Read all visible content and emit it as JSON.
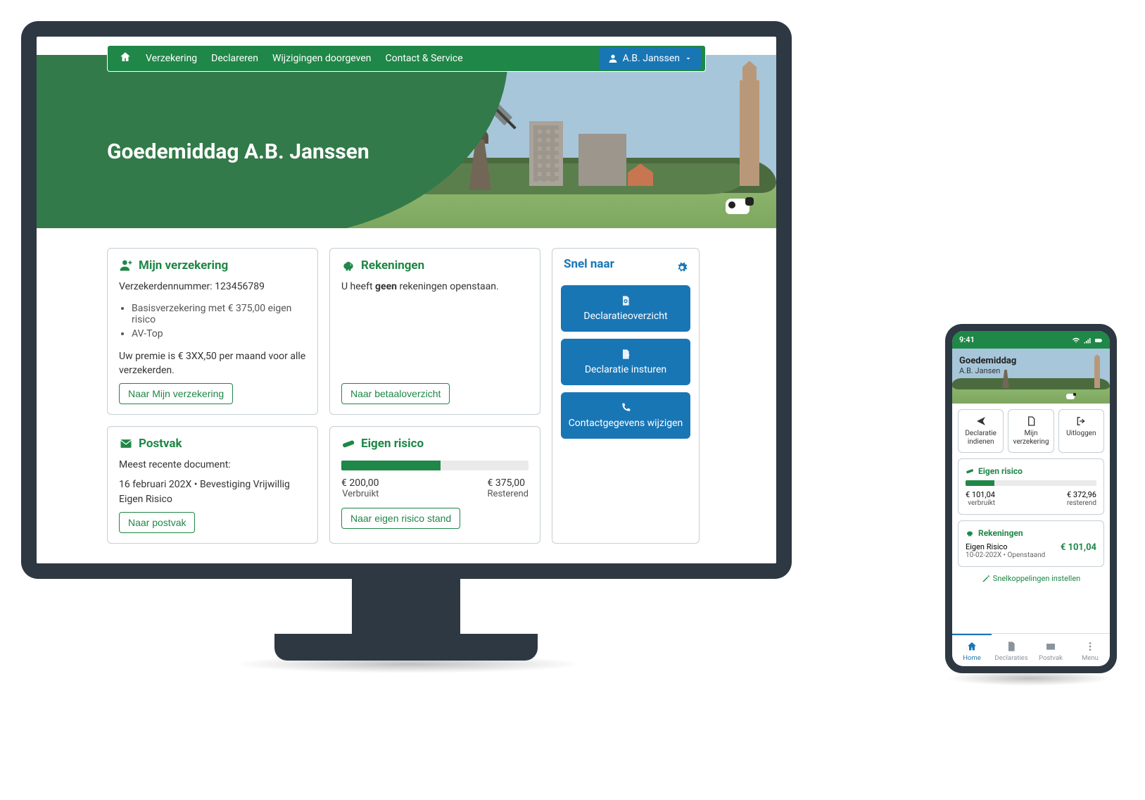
{
  "desktop": {
    "nav": {
      "items": [
        "Verzekering",
        "Declareren",
        "Wijzigingen doorgeven",
        "Contact & Service"
      ],
      "user_name": "A.B. Janssen"
    },
    "greeting": "Goedemiddag A.B. Janssen",
    "verzekering": {
      "title": "Mijn verzekering",
      "nummer_label": "Verzekerdennummer: 123456789",
      "bullets": [
        "Basisverzekering met € 375,00 eigen risico",
        "AV-Top"
      ],
      "premie": "Uw premie is € 3XX,50 per maand voor alle verzekerden.",
      "button": "Naar Mijn verzekering"
    },
    "rekeningen": {
      "title": "Rekeningen",
      "text_pre": "U heeft ",
      "text_bold": "geen",
      "text_post": " rekeningen openstaan.",
      "button": "Naar betaaloverzicht"
    },
    "postvak": {
      "title": "Postvak",
      "sub": "Meest recente document:",
      "doc": "16 februari 202X • Bevestiging Vrijwillig Eigen Risico",
      "button": "Naar postvak"
    },
    "risico": {
      "title": "Eigen risico",
      "progress_pct": 53,
      "verbruikt_val": "€ 200,00",
      "verbruikt_lbl": "Verbruikt",
      "rest_val": "€ 375,00",
      "rest_lbl": "Resterend",
      "button": "Naar eigen risico stand"
    },
    "snel": {
      "title": "Snel naar",
      "buttons": [
        "Declaratieoverzicht",
        "Declaratie insturen",
        "Contactgegevens wijzigen"
      ]
    }
  },
  "mobile": {
    "time": "9:41",
    "greeting": "Goedemiddag",
    "name": "A.B. Jansen",
    "tiles": [
      "Declaratie indienen",
      "Mijn verzekering",
      "Uitloggen"
    ],
    "risico": {
      "title": "Eigen risico",
      "progress_pct": 22,
      "verbruikt_val": "€ 101,04",
      "verbruikt_lbl": "verbruikt",
      "rest_val": "€ 372,96",
      "rest_lbl": "resterend"
    },
    "rekeningen": {
      "title": "Rekeningen",
      "line1": "Eigen Risico",
      "line2": "10-02-202X • Openstaand",
      "amount": "€ 101,04"
    },
    "snelkop": "Snelkoppelingen instellen",
    "tabs": [
      "Home",
      "Declaraties",
      "Postvak",
      "Menu"
    ]
  }
}
